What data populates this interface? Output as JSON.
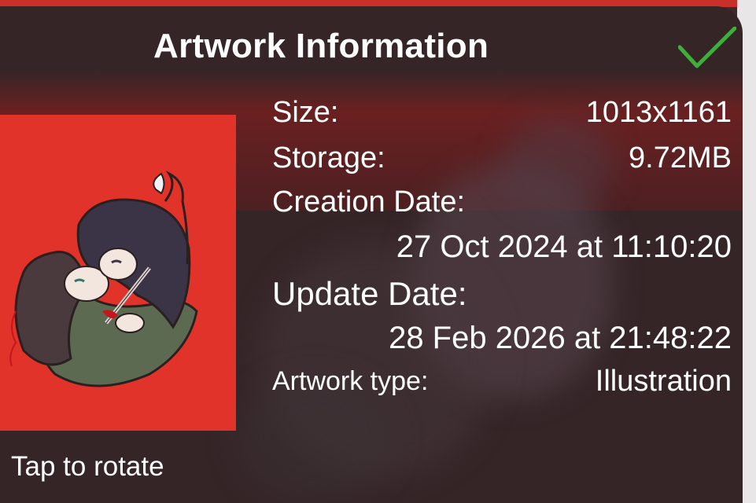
{
  "sheet": {
    "title": "Artwork Information",
    "confirm_icon": "checkmark-icon",
    "confirm_color": "#3fae3a"
  },
  "artwork": {
    "background_color": "#e2332a",
    "rotate_hint": "Tap to rotate"
  },
  "info": {
    "size_label": "Size:",
    "size_value": "1013x1161",
    "storage_label": "Storage:",
    "storage_value": "9.72MB",
    "creation_label": "Creation Date:",
    "creation_value": "27 Oct 2024 at 11:10:20",
    "update_label": "Update Date:",
    "update_value": "28 Feb 2026 at 21:48:22",
    "type_label": "Artwork type:",
    "type_value": "Illustration"
  }
}
